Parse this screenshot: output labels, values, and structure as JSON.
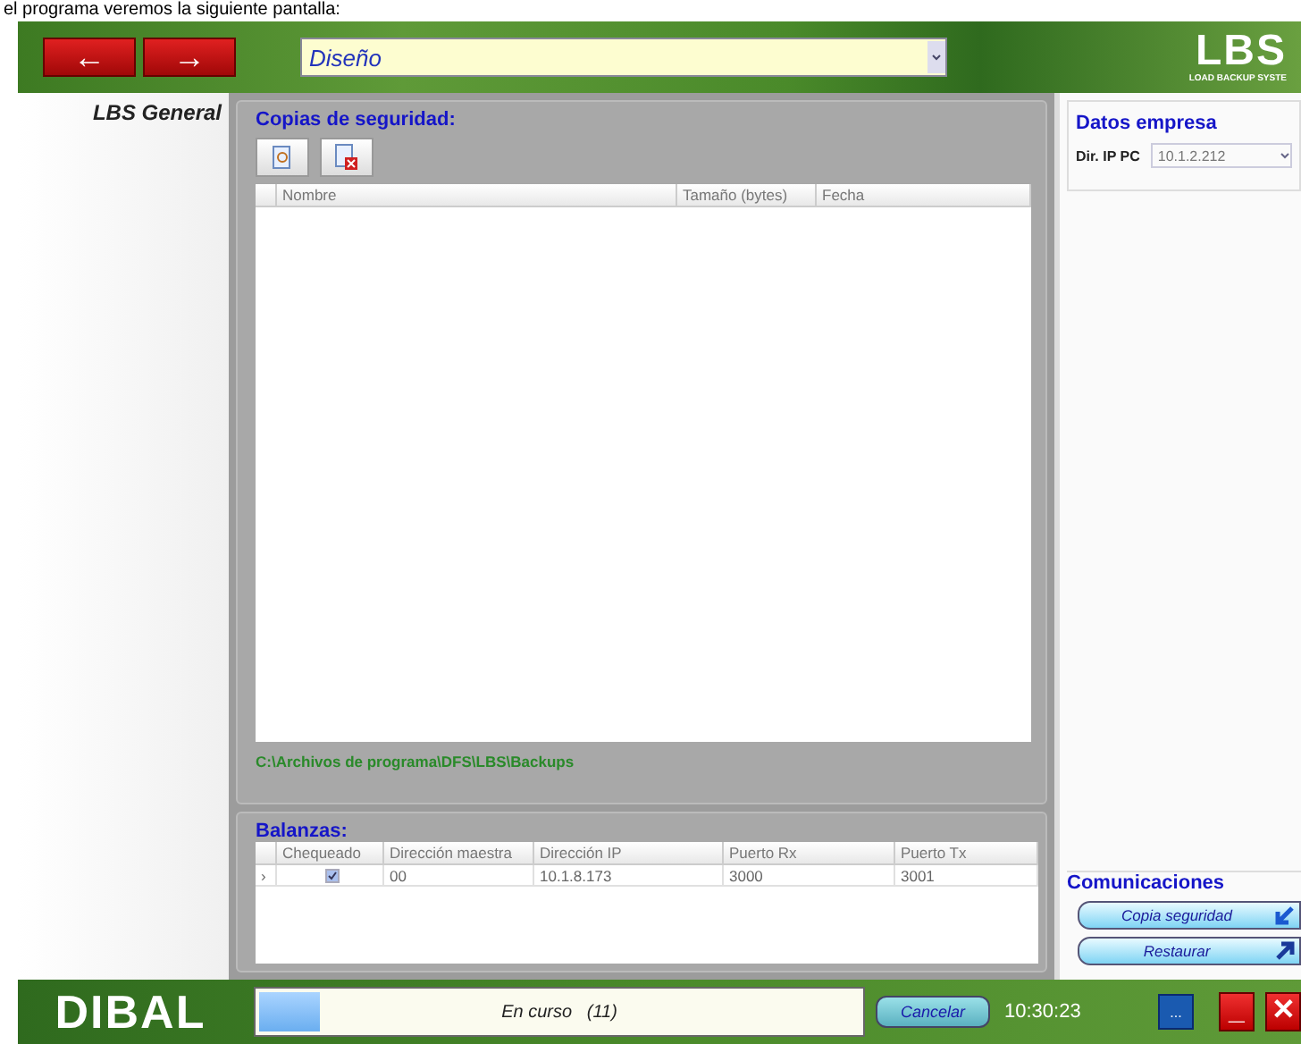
{
  "caption": "el programa veremos la siguiente pantalla:",
  "header": {
    "back": "←",
    "forward": "→",
    "module": {
      "value": "Diseño"
    },
    "logo": {
      "mark": "LBS",
      "tagline": "LOAD BACKUP SYSTE"
    }
  },
  "sidebar": {
    "title": "LBS General"
  },
  "backups": {
    "title": "Copias de seguridad:",
    "columns": [
      "Nombre",
      "Tamaño (bytes)",
      "Fecha"
    ],
    "path": "C:\\Archivos de programa\\DFS\\LBS\\Backups"
  },
  "scales": {
    "title": "Balanzas:",
    "columns": [
      "Chequeado",
      "Dirección maestra",
      "Dirección IP",
      "Puerto Rx",
      "Puerto Tx"
    ],
    "rows": [
      {
        "pointer": "›",
        "checked": true,
        "master": "00",
        "ip": "10.1.8.173",
        "rx": "3000",
        "tx": "3001"
      }
    ]
  },
  "company": {
    "title": "Datos empresa",
    "ip_label": "Dir. IP PC",
    "ip_value": "10.1.2.212"
  },
  "comms": {
    "title": "Comunicaciones",
    "buttons": [
      {
        "label": "Copia seguridad",
        "kind": "down"
      },
      {
        "label": "Restaurar",
        "kind": "up"
      }
    ]
  },
  "footer": {
    "logo": "DIBAL",
    "status": "En curso   (11)",
    "level": 0.1,
    "cancel": "Cancelar",
    "time": "10:30:23",
    "dots": "...",
    "minimize": "_",
    "close": "✕"
  }
}
